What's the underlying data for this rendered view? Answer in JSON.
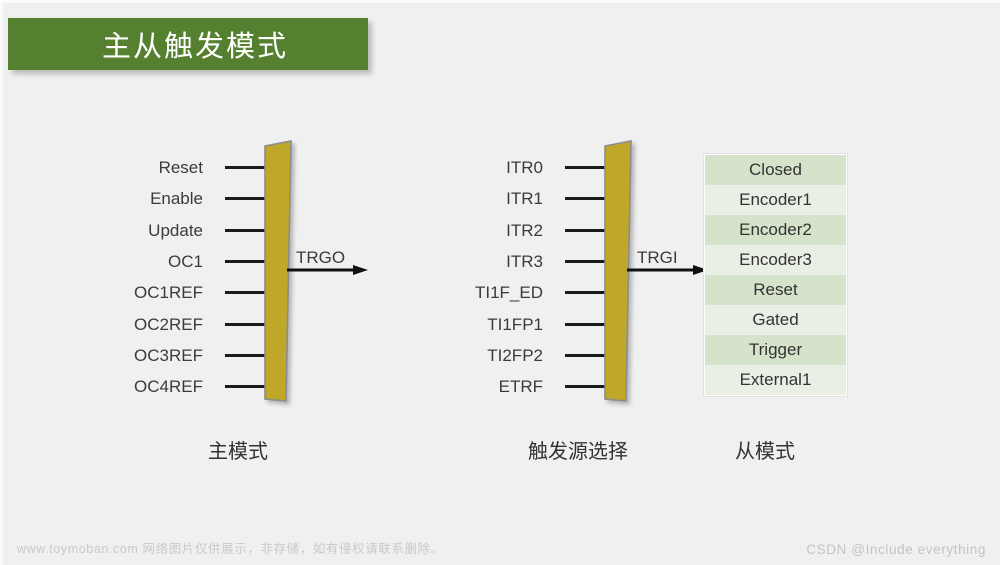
{
  "title": {
    "text": "主从触发模式",
    "banner_color": "#54802f"
  },
  "diagram": {
    "master": {
      "caption": "主模式",
      "pins": [
        "Reset",
        "Enable",
        "Update",
        "OC1",
        "OC1REF",
        "OC2REF",
        "OC3REF",
        "OC4REF"
      ],
      "output_label": "TRGO",
      "block_color": "#bfa829"
    },
    "trigger_source": {
      "caption": "触发源选择",
      "pins": [
        "ITR0",
        "ITR1",
        "ITR2",
        "ITR3",
        "TI1F_ED",
        "TI1FP1",
        "TI2FP2",
        "ETRF"
      ],
      "output_label": "TRGI",
      "block_color": "#bfa829"
    },
    "slave": {
      "caption": "从模式",
      "modes": [
        "Closed",
        "Encoder1",
        "Encoder2",
        "Encoder3",
        "Reset",
        "Gated",
        "Trigger",
        "External1"
      ],
      "row_color_odd": "#d6e3cb",
      "row_color_even": "#eaefe6"
    }
  },
  "footer": {
    "left": "www.toymoban.com 网络图片仅供展示，非存储，如有侵权请联系删除。",
    "right": "CSDN @Include everything"
  }
}
